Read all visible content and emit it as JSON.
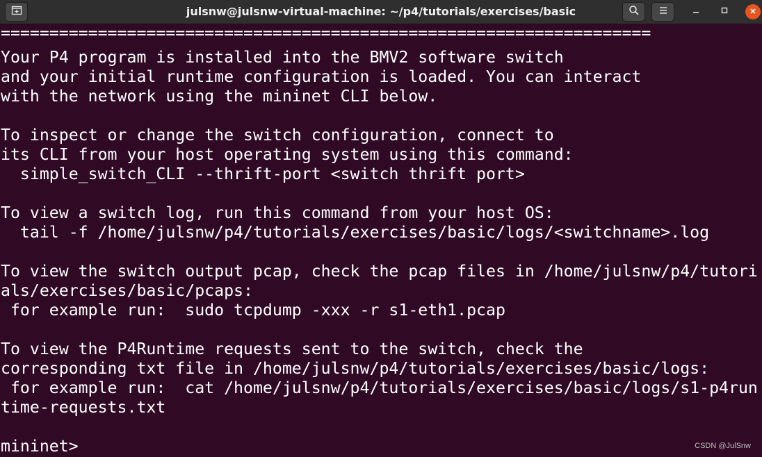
{
  "window": {
    "title": "julsnw@julsnw-virtual-machine: ~/p4/tutorials/exercises/basic"
  },
  "titlebar": {
    "buttons": [
      {
        "name": "new-tab",
        "icon": "new-tab-icon"
      },
      {
        "name": "search",
        "icon": "search-icon"
      },
      {
        "name": "menu",
        "icon": "hamburger-menu-icon"
      },
      {
        "name": "minimize",
        "icon": "minimize-icon"
      },
      {
        "name": "maximize",
        "icon": "maximize-icon"
      },
      {
        "name": "close",
        "icon": "close-icon"
      }
    ]
  },
  "terminal": {
    "lines": [
      "===================================================================",
      "Your P4 program is installed into the BMV2 software switch",
      "and your initial runtime configuration is loaded. You can interact",
      "with the network using the mininet CLI below.",
      "",
      "To inspect or change the switch configuration, connect to",
      "its CLI from your host operating system using this command:",
      "  simple_switch_CLI --thrift-port <switch thrift port>",
      "",
      "To view a switch log, run this command from your host OS:",
      "  tail -f /home/julsnw/p4/tutorials/exercises/basic/logs/<switchname>.log",
      "",
      "To view the switch output pcap, check the pcap files in /home/julsnw/p4/tutori",
      "als/exercises/basic/pcaps:",
      " for example run:  sudo tcpdump -xxx -r s1-eth1.pcap",
      "",
      "To view the P4Runtime requests sent to the switch, check the",
      "corresponding txt file in /home/julsnw/p4/tutorials/exercises/basic/logs:",
      " for example run:  cat /home/julsnw/p4/tutorials/exercises/basic/logs/s1-p4run",
      "time-requests.txt",
      "",
      "mininet>"
    ]
  },
  "watermark": "CSDN @JulSnw",
  "colors": {
    "terminal_background": "#300a24",
    "terminal_text": "#ffffff",
    "titlebar_background": "#2f2f2f",
    "close_button": "#e95420"
  }
}
